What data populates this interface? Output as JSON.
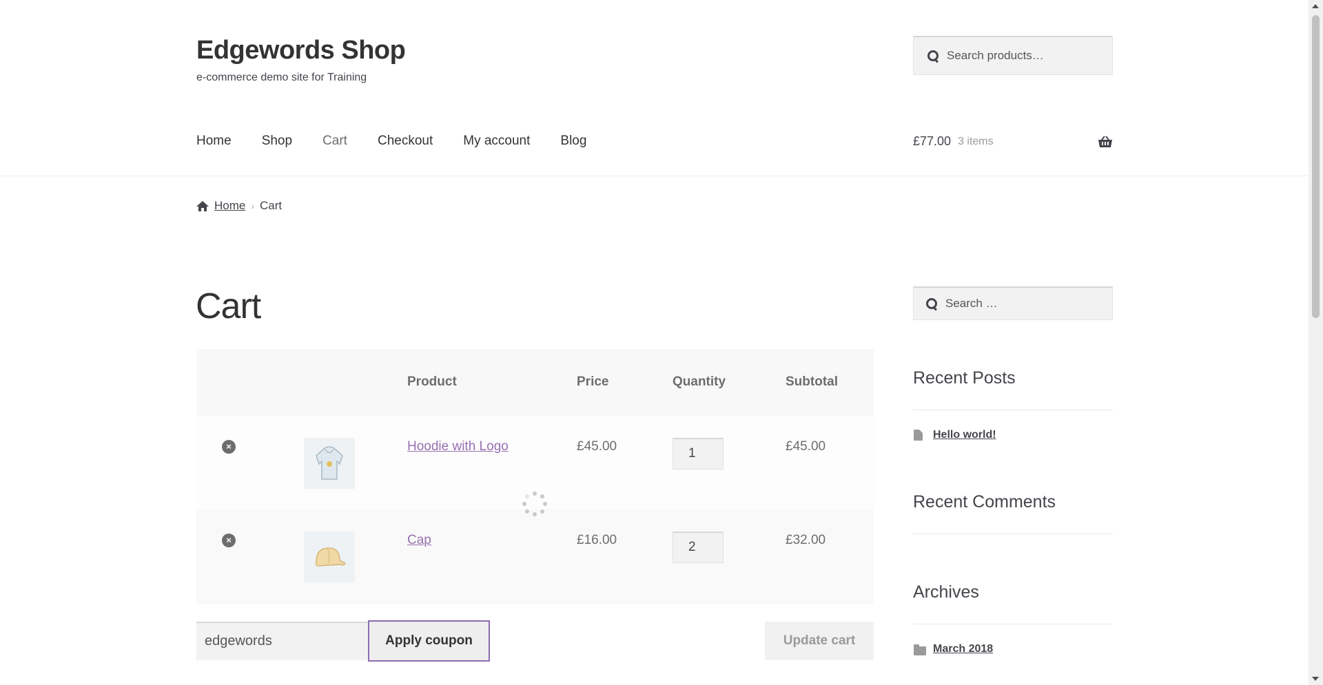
{
  "site": {
    "title": "Edgewords Shop",
    "description": "e-commerce demo site for Training"
  },
  "header_search": {
    "placeholder": "Search products…"
  },
  "nav": {
    "items": [
      "Home",
      "Shop",
      "Cart",
      "Checkout",
      "My account",
      "Blog"
    ],
    "current": "Cart"
  },
  "mini_cart": {
    "amount": "£77.00",
    "count": "3 items"
  },
  "breadcrumb": {
    "home": "Home",
    "current": "Cart"
  },
  "page": {
    "title": "Cart"
  },
  "cart": {
    "headers": {
      "product": "Product",
      "price": "Price",
      "quantity": "Quantity",
      "subtotal": "Subtotal"
    },
    "rows": [
      {
        "remove": "×",
        "product": "Hoodie with Logo",
        "price": "£45.00",
        "quantity": "1",
        "subtotal": "£45.00"
      },
      {
        "remove": "×",
        "product": "Cap",
        "price": "£16.00",
        "quantity": "2",
        "subtotal": "£32.00"
      }
    ]
  },
  "coupon": {
    "value": "edgewords",
    "apply_label": "Apply coupon",
    "update_label": "Update cart"
  },
  "sidebar": {
    "search_placeholder": "Search …",
    "recent_posts_title": "Recent Posts",
    "recent_posts": [
      "Hello world!"
    ],
    "recent_comments_title": "Recent Comments",
    "archives_title": "Archives",
    "archives": [
      "March 2018"
    ]
  },
  "colors": {
    "link_purple": "#9670b0",
    "button_focus_border": "#8b6bb5"
  }
}
